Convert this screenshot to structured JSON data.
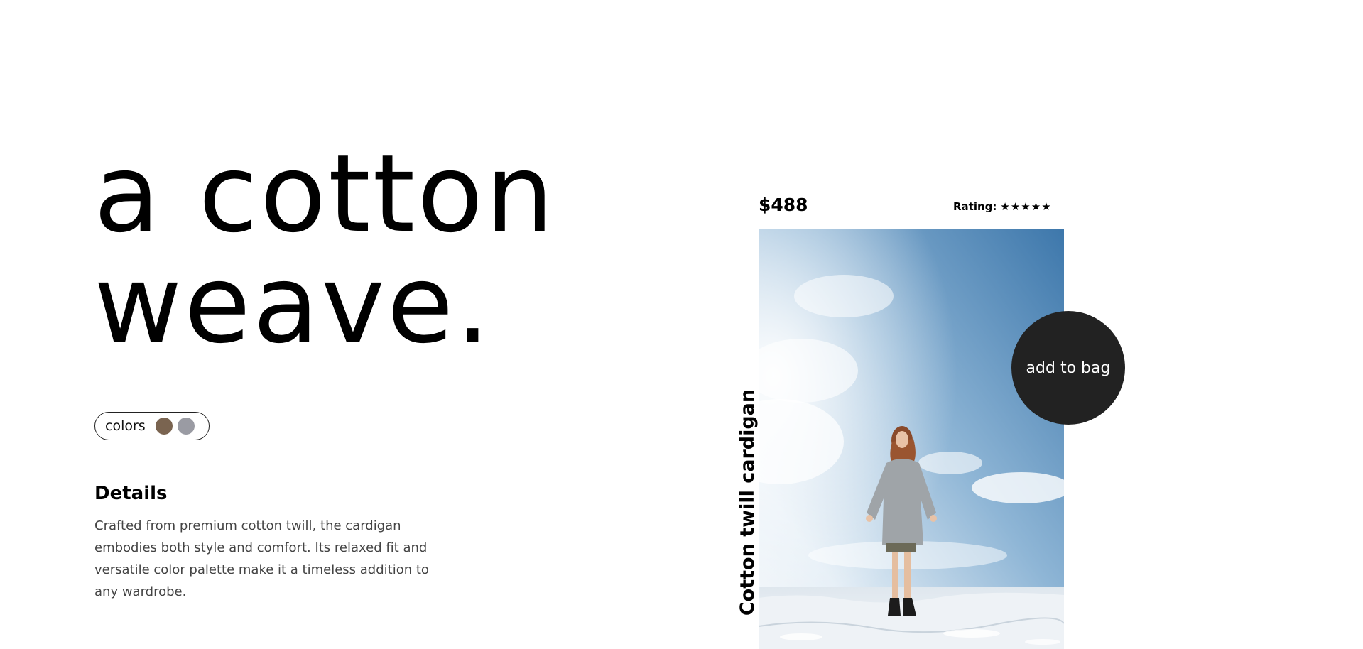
{
  "hero": {
    "line1": "a cotton",
    "line2": "weave."
  },
  "colors": {
    "label": "colors",
    "swatches": [
      "#7a6450",
      "#9a9ba3"
    ]
  },
  "details": {
    "heading": "Details",
    "body": "Crafted from premium cotton twill, the cardigan embodies both style and comfort. Its relaxed fit and versatile color palette make it a timeless addition to any wardrobe."
  },
  "product": {
    "price": "$488",
    "rating_label": "Rating:",
    "rating_stars": "★★★★★",
    "name": "Cotton twill cardigan",
    "add_to_bag_label": "add to bag"
  },
  "colors_theme": {
    "button_bg": "#222222",
    "sky_top": "#3f78ac",
    "snow": "#eef2f6"
  }
}
